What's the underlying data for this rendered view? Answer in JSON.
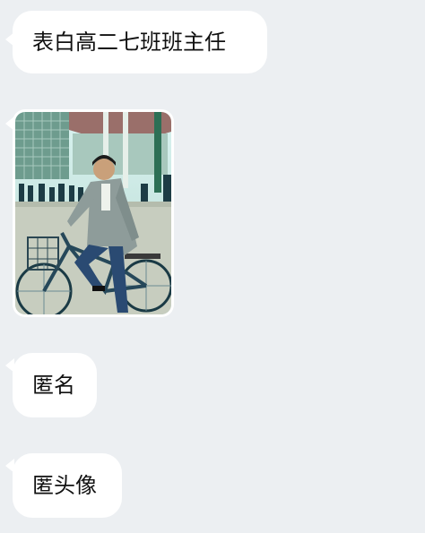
{
  "messages": [
    {
      "type": "text",
      "text": "表白高二七班班主任"
    },
    {
      "type": "image",
      "icon": "photo-man-on-bicycle"
    },
    {
      "type": "text",
      "text": "匿名"
    },
    {
      "type": "text",
      "text": "匿头像"
    }
  ],
  "colors": {
    "background": "#eceff2",
    "bubble": "#ffffff",
    "text": "#111111"
  }
}
